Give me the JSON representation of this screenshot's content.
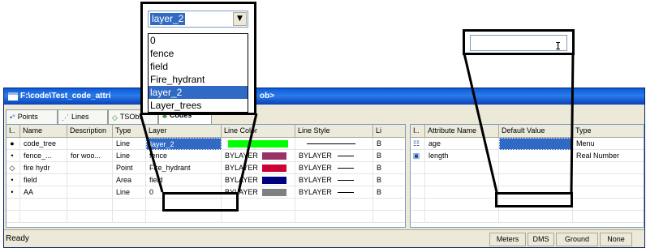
{
  "window": {
    "title_left": "F:\\code\\Test_code_attri",
    "title_right": "ob>"
  },
  "tabs": [
    {
      "label": "Points",
      "icon": "points-icon"
    },
    {
      "label": "Lines",
      "icon": "lines-icon"
    },
    {
      "label": "TSObs",
      "icon": "tsobs-icon"
    },
    {
      "label": "Codes",
      "icon": "codes-icon"
    }
  ],
  "codes_grid": {
    "headers": [
      "I..",
      "Name",
      "Description",
      "Type",
      "Layer",
      "Line Color",
      "Line Style",
      "Li"
    ],
    "rows": [
      {
        "mark": "●",
        "name": "code_tree",
        "description": "",
        "type": "Line",
        "layer": "layer_2",
        "color_label": "",
        "color": "#00ff00",
        "style_label": "",
        "li": "B"
      },
      {
        "mark": "•",
        "name": "fence_...",
        "description": "for woo...",
        "type": "Line",
        "layer": "fence",
        "color_label": "BYLAYER",
        "color": "#993366",
        "style_label": "BYLAYER",
        "li": "B"
      },
      {
        "mark": "◇",
        "name": "fire hydr",
        "description": "",
        "type": "Point",
        "layer": "Fire_hydrant",
        "color_label": "BYLAYER",
        "color": "#cc0033",
        "style_label": "BYLAYER",
        "li": "B"
      },
      {
        "mark": "•",
        "name": "field",
        "description": "",
        "type": "Area",
        "layer": "field",
        "color_label": "BYLAYER",
        "color": "#000080",
        "style_label": "BYLAYER",
        "li": "B"
      },
      {
        "mark": "•",
        "name": "AA",
        "description": "",
        "type": "Line",
        "layer": "0",
        "color_label": "BYLAYER",
        "color": "#808080",
        "style_label": "BYLAYER",
        "li": "B"
      }
    ]
  },
  "attr_grid": {
    "headers": [
      "I..",
      "Attribute Name",
      "Default Value",
      "Type"
    ],
    "rows": [
      {
        "icon": "menu-attr-icon",
        "name": "age",
        "default": "",
        "type": "Menu"
      },
      {
        "icon": "number-attr-icon",
        "name": "length",
        "default": "",
        "type": "Real Number"
      }
    ]
  },
  "status": {
    "text": "Ready",
    "panels": [
      "Meters",
      "DMS",
      "Ground",
      "None"
    ]
  },
  "layer_dropdown": {
    "selected": "layer_2",
    "options": [
      "0",
      "fence",
      "field",
      "Fire_hydrant",
      "layer_2",
      "Layer_trees"
    ],
    "highlighted": "layer_2"
  }
}
